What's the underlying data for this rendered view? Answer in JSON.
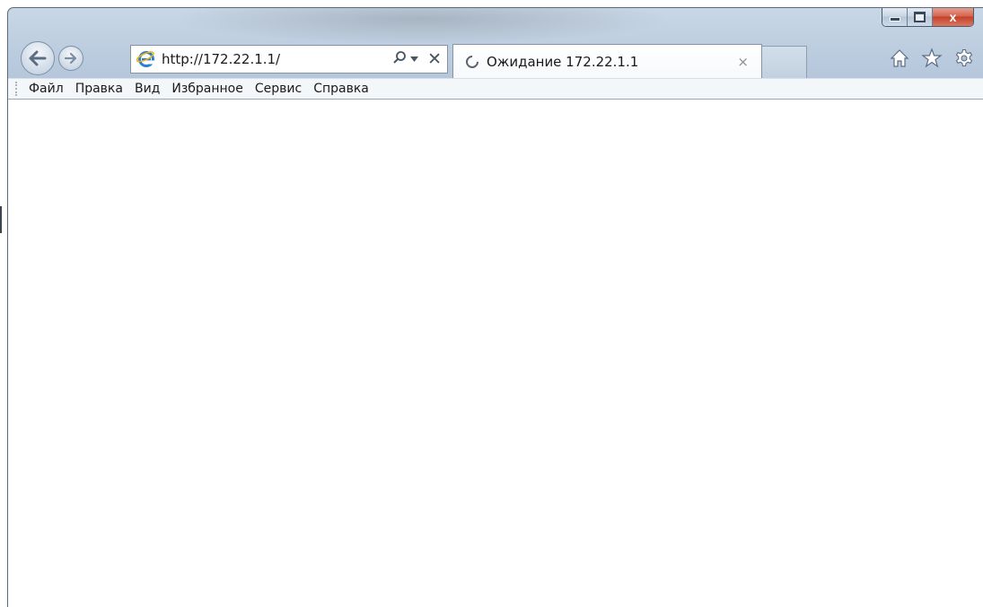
{
  "window": {
    "controls": {
      "minimize_icon": "minimize-icon",
      "maximize_icon": "maximize-icon",
      "close_label": "x"
    }
  },
  "nav": {
    "back_icon": "back-arrow-icon",
    "forward_icon": "forward-arrow-icon"
  },
  "address_bar": {
    "url": "http://172.22.1.1/",
    "search_icon": "search-icon",
    "dropdown_icon": "dropdown-icon",
    "stop_label": "✕"
  },
  "tab": {
    "title": "Ожидание 172.22.1.1",
    "close_label": "×",
    "loading_icon": "loading-spinner-icon"
  },
  "toolbar": {
    "home_label": "⌂",
    "favorites_label": "★",
    "tools_label": "⚙"
  },
  "menubar": {
    "items": [
      {
        "label": "Файл"
      },
      {
        "label": "Правка"
      },
      {
        "label": "Вид"
      },
      {
        "label": "Избранное"
      },
      {
        "label": "Сервис"
      },
      {
        "label": "Справка"
      }
    ]
  },
  "colors": {
    "frame": "#b9cade",
    "close_button": "#c4402a",
    "content_background": "#ffffff"
  }
}
